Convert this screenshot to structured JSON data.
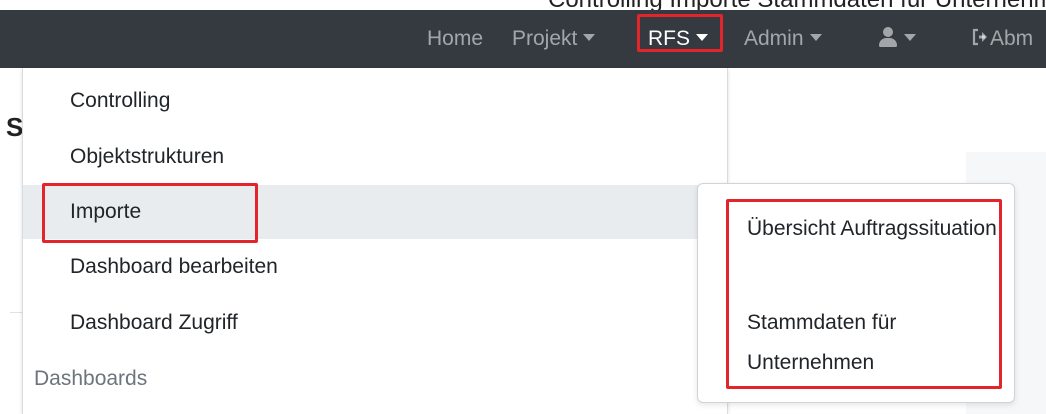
{
  "caption": {
    "text": "Controlling Importe Stammdaten für Unternehmen – Navigation"
  },
  "navbar": {
    "home": "Home",
    "projekt": "Projekt",
    "rfs": "RFS",
    "admin": "Admin",
    "abmelden": "Abm",
    "background_color": "#343a40",
    "icons": [
      "user-icon",
      "caret-down-icon",
      "sign-out-icon"
    ]
  },
  "page": {
    "heading_letter": "S"
  },
  "rfs_menu": {
    "items": [
      {
        "label": "Controlling"
      },
      {
        "label": "Objektstrukturen"
      },
      {
        "label": "Importe"
      },
      {
        "label": "Dashboard bearbeiten"
      },
      {
        "label": "Dashboard Zugriff"
      }
    ],
    "section_header": "Dashboards"
  },
  "importe_submenu": {
    "items": [
      {
        "label": "Übersicht Auftragssituation"
      },
      {
        "label": "Stammdaten für Unternehmen"
      }
    ]
  },
  "highlight_color": "#e3242b"
}
